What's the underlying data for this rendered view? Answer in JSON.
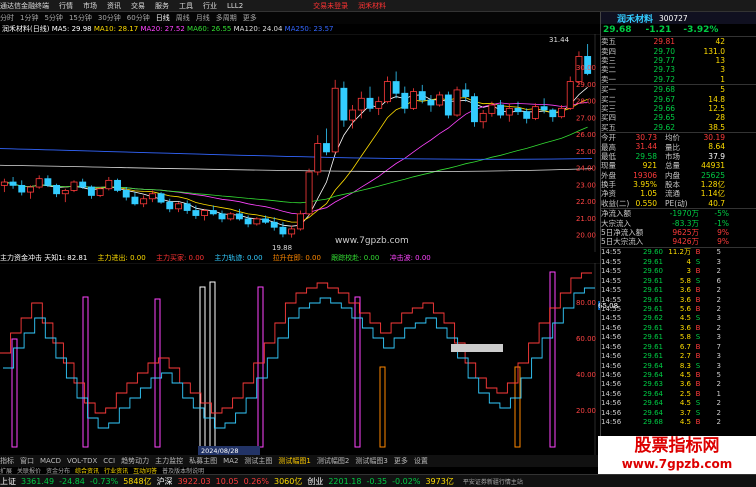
{
  "titlebar": {
    "items": [
      "通达信金融终端",
      "行情",
      "市场",
      "资讯",
      "交易",
      "服务",
      "工具",
      "行业",
      "LLL2"
    ],
    "promo1": "交易未登录",
    "promo2": "润禾材料"
  },
  "periods": [
    "分时",
    "1分钟",
    "5分钟",
    "15分钟",
    "30分钟",
    "60分钟",
    "日线",
    "周线",
    "月线",
    "多周期",
    "更多"
  ],
  "active_period": "日线",
  "ma_info": {
    "name": "润禾材料(日线)",
    "ma5": "MA5: 29.98",
    "ma10": "MA10: 28.17",
    "ma20": "MA20: 27.52",
    "ma60": "MA60: 26.55",
    "ma120": "MA120: 24.04",
    "ma250": "MA250: 23.57"
  },
  "price_axis": [
    "30.00",
    "29.00",
    "28.00",
    "27.00",
    "26.00",
    "25.00",
    "24.00",
    "23.00",
    "22.00",
    "21.00",
    "20.00"
  ],
  "high_label": "31.44",
  "low_label": "19.88",
  "watermark_mid": "www.7gpzb.com",
  "indicator_line": {
    "name": "主力资金冲击",
    "param": "天知1: 82.81",
    "i1": "主力进出: 0.00",
    "i2": "主力买家: 0.00",
    "i3": "主力轨迹: 0.00",
    "i4": "拉升在即: 0.00",
    "i5": "跟踪校赴: 0.00",
    "i6": "冲击波: 0.00"
  },
  "ind_axis": [
    "80.00",
    "60.00",
    "40.00",
    "20.00"
  ],
  "ind_marker": "65.08",
  "date_label": "2024/08/28",
  "tabs": [
    "指标",
    "窗口",
    "MACD",
    "VOL-TDX",
    "CCI",
    "趋势动力",
    "主力监控",
    "私募主图",
    "MA2",
    "测试主图",
    "测试幅图1",
    "测试幅图2",
    "测试幅图3",
    "更多",
    "设置"
  ],
  "link_items": [
    "扩展",
    "关联报价",
    "资金分布",
    "综合资讯",
    "行业资讯",
    "互动问答",
    "普及版本制说明"
  ],
  "stock": {
    "name": "润禾材料",
    "code": "300727",
    "price": "29.68",
    "change": "-1.21",
    "pct": "-3.92%"
  },
  "asks": [
    {
      "label": "卖五",
      "price": "29.81",
      "vol": "42"
    },
    {
      "label": "卖四",
      "price": "29.70",
      "vol": "131.0"
    },
    {
      "label": "卖三",
      "price": "29.77",
      "vol": "13"
    },
    {
      "label": "卖二",
      "price": "29.73",
      "vol": "3"
    },
    {
      "label": "卖一",
      "price": "29.72",
      "vol": "1"
    }
  ],
  "bids": [
    {
      "label": "买一",
      "price": "29.68",
      "vol": "5"
    },
    {
      "label": "买二",
      "price": "29.67",
      "vol": "14.8"
    },
    {
      "label": "买三",
      "price": "29.66",
      "vol": "12.5"
    },
    {
      "label": "买四",
      "price": "29.65",
      "vol": "28"
    },
    {
      "label": "买五",
      "price": "29.62",
      "vol": "38.5"
    }
  ],
  "stats": [
    {
      "l1": "今开",
      "v1": "30.73",
      "l2": "均价",
      "v2": "30.19"
    },
    {
      "l1": "最高",
      "v1": "31.44",
      "l2": "量比",
      "v2": "8.64"
    },
    {
      "l1": "最低",
      "v1": "29.58",
      "l2": "市场",
      "v2": "37.9"
    },
    {
      "l1": "现量",
      "v1": "921",
      "l2": "总量",
      "v2": "44931"
    },
    {
      "l1": "外盘",
      "v1": "19306",
      "l2": "内盘",
      "v2": "25625"
    },
    {
      "l1": "换手",
      "v1": "3.95%",
      "l2": "股本",
      "v2": "1.28亿"
    },
    {
      "l1": "净资",
      "v1": "1.05",
      "l2": "流通",
      "v2": "1.14亿"
    },
    {
      "l1": "收益(二)",
      "v1": "0.550",
      "l2": "PE(动)",
      "v2": "40.7"
    }
  ],
  "flows": [
    {
      "label": "净流入额",
      "value": "-1970万",
      "pct": "-5%"
    },
    {
      "label": "大宗流入",
      "value": "-83.3万",
      "pct": "-1%"
    },
    {
      "label": "5日净流入额",
      "value": "9625万",
      "pct": "9%"
    },
    {
      "label": "5日大宗流入",
      "value": "9426万",
      "pct": "9%"
    }
  ],
  "ticks": [
    {
      "t": "14:55",
      "p": "29.60",
      "v": "11.2万",
      "d": "B",
      "n": "5"
    },
    {
      "t": "14:55",
      "p": "29.61",
      "v": "4",
      "d": "S",
      "n": "3"
    },
    {
      "t": "14:55",
      "p": "29.60",
      "v": "3",
      "d": "B",
      "n": "2"
    },
    {
      "t": "14:55",
      "p": "29.61",
      "v": "5.8",
      "d": "S",
      "n": "6"
    },
    {
      "t": "14:55",
      "p": "29.61",
      "v": "3.6",
      "d": "B",
      "n": "2"
    },
    {
      "t": "14:55",
      "p": "29.61",
      "v": "3.6",
      "d": "B",
      "n": "2"
    },
    {
      "t": "14:55",
      "p": "29.61",
      "v": "5.6",
      "d": "B",
      "n": "2"
    },
    {
      "t": "14:55",
      "p": "29.62",
      "v": "4.5",
      "d": "S",
      "n": "3"
    },
    {
      "t": "14:56",
      "p": "29.61",
      "v": "3.6",
      "d": "B",
      "n": "2"
    },
    {
      "t": "14:56",
      "p": "29.61",
      "v": "5.8",
      "d": "S",
      "n": "3"
    },
    {
      "t": "14:56",
      "p": "29.61",
      "v": "6.7",
      "d": "B",
      "n": "7"
    },
    {
      "t": "14:56",
      "p": "29.61",
      "v": "2.7",
      "d": "B",
      "n": "3"
    },
    {
      "t": "14:56",
      "p": "29.64",
      "v": "8.3",
      "d": "S",
      "n": "3"
    },
    {
      "t": "14:56",
      "p": "29.64",
      "v": "4.5",
      "d": "B",
      "n": "5"
    },
    {
      "t": "14:56",
      "p": "29.63",
      "v": "3.6",
      "d": "B",
      "n": "2"
    },
    {
      "t": "14:56",
      "p": "29.64",
      "v": "2.5",
      "d": "B",
      "n": "1"
    },
    {
      "t": "14:56",
      "p": "29.64",
      "v": "4.5",
      "d": "S",
      "n": "2"
    },
    {
      "t": "14:56",
      "p": "29.64",
      "v": "3.7",
      "d": "S",
      "n": "2"
    },
    {
      "t": "14:56",
      "p": "29.68",
      "v": "4.5",
      "d": "B",
      "n": "2"
    }
  ],
  "status": [
    {
      "name": "上证",
      "val": "3361.49",
      "chg": "-24.84",
      "pct": "-0.73%",
      "vol": "5848亿"
    },
    {
      "name": "沪深",
      "val": "3922.03",
      "chg": "10.05",
      "pct": "0.26%",
      "vol": "3060亿"
    },
    {
      "name": "创业",
      "val": "2201.18",
      "chg": "-0.35",
      "pct": "-0.02%",
      "vol": "3973亿"
    }
  ],
  "status_right": "平安证券新疆行情主站",
  "side_labels": [
    "分",
    "笔",
    "价",
    "细",
    "势",
    "指",
    "联",
    "值",
    "序",
    "务",
    "成",
    "事",
    "析"
  ],
  "watermark_big": "股票指标网",
  "watermark_small": "www.7gpzb.com",
  "chart_data": {
    "type": "candlestick",
    "y_range": [
      19.5,
      31.8
    ],
    "candles": [
      [
        23.0,
        23.4,
        22.6,
        23.2
      ],
      [
        23.2,
        23.5,
        22.8,
        23.0
      ],
      [
        23.0,
        23.3,
        22.4,
        22.6
      ],
      [
        22.6,
        23.0,
        22.2,
        22.9
      ],
      [
        22.9,
        23.6,
        22.8,
        23.4
      ],
      [
        23.4,
        23.6,
        22.9,
        23.0
      ],
      [
        23.0,
        23.1,
        22.3,
        22.5
      ],
      [
        22.5,
        22.8,
        22.0,
        22.7
      ],
      [
        22.7,
        23.3,
        22.6,
        23.2
      ],
      [
        23.2,
        23.4,
        22.8,
        22.9
      ],
      [
        22.9,
        23.0,
        22.2,
        22.4
      ],
      [
        22.4,
        22.9,
        22.3,
        22.8
      ],
      [
        22.8,
        23.5,
        22.7,
        23.3
      ],
      [
        23.3,
        23.4,
        22.6,
        22.7
      ],
      [
        22.7,
        22.9,
        22.1,
        22.3
      ],
      [
        22.3,
        22.6,
        21.8,
        21.9
      ],
      [
        21.9,
        22.4,
        21.7,
        22.2
      ],
      [
        22.2,
        22.7,
        22.0,
        22.5
      ],
      [
        22.5,
        22.6,
        21.9,
        22.0
      ],
      [
        22.0,
        22.2,
        21.4,
        21.6
      ],
      [
        21.6,
        22.0,
        21.4,
        21.9
      ],
      [
        21.9,
        22.1,
        21.3,
        21.5
      ],
      [
        21.5,
        21.8,
        21.0,
        21.2
      ],
      [
        21.2,
        21.6,
        20.9,
        21.5
      ],
      [
        21.5,
        21.8,
        21.2,
        21.3
      ],
      [
        21.3,
        21.5,
        20.8,
        21.0
      ],
      [
        21.0,
        21.4,
        20.9,
        21.3
      ],
      [
        21.3,
        21.6,
        20.9,
        21.0
      ],
      [
        21.0,
        21.2,
        20.5,
        20.7
      ],
      [
        20.7,
        21.1,
        20.6,
        21.0
      ],
      [
        21.0,
        21.2,
        20.7,
        20.8
      ],
      [
        20.8,
        21.1,
        20.3,
        20.5
      ],
      [
        20.5,
        20.8,
        19.9,
        20.1
      ],
      [
        20.1,
        20.6,
        19.88,
        20.4
      ],
      [
        20.4,
        21.5,
        20.3,
        21.3
      ],
      [
        21.3,
        24.0,
        21.2,
        23.8
      ],
      [
        23.8,
        26.0,
        23.6,
        25.5
      ],
      [
        25.5,
        26.4,
        24.8,
        25.0
      ],
      [
        25.0,
        29.3,
        24.9,
        28.8
      ],
      [
        28.8,
        29.2,
        26.5,
        26.9
      ],
      [
        26.9,
        27.8,
        26.4,
        27.5
      ],
      [
        27.5,
        28.6,
        27.0,
        28.2
      ],
      [
        28.2,
        28.9,
        27.4,
        27.6
      ],
      [
        27.6,
        28.3,
        27.2,
        28.0
      ],
      [
        28.0,
        29.5,
        27.9,
        29.2
      ],
      [
        29.2,
        29.8,
        28.2,
        28.5
      ],
      [
        28.5,
        28.9,
        27.3,
        27.6
      ],
      [
        27.6,
        28.8,
        27.5,
        28.6
      ],
      [
        28.6,
        29.0,
        27.9,
        28.1
      ],
      [
        28.1,
        28.4,
        27.4,
        27.8
      ],
      [
        27.8,
        28.6,
        27.7,
        28.4
      ],
      [
        28.4,
        28.6,
        27.0,
        27.2
      ],
      [
        27.2,
        28.9,
        27.1,
        28.7
      ],
      [
        28.7,
        29.1,
        28.0,
        28.3
      ],
      [
        28.3,
        28.5,
        26.5,
        26.8
      ],
      [
        26.8,
        27.5,
        26.4,
        27.3
      ],
      [
        27.3,
        28.0,
        27.1,
        27.8
      ],
      [
        27.8,
        28.1,
        27.0,
        27.2
      ],
      [
        27.2,
        27.9,
        26.8,
        27.6
      ],
      [
        27.6,
        28.0,
        27.2,
        27.4
      ],
      [
        27.4,
        27.6,
        26.7,
        27.0
      ],
      [
        27.0,
        27.9,
        26.9,
        27.7
      ],
      [
        27.7,
        28.2,
        27.3,
        27.5
      ],
      [
        27.5,
        27.6,
        26.8,
        27.1
      ],
      [
        27.1,
        27.8,
        27.0,
        27.6
      ],
      [
        27.6,
        29.5,
        27.5,
        29.2
      ],
      [
        29.2,
        31.0,
        29.0,
        30.7
      ],
      [
        30.7,
        31.44,
        29.58,
        29.68
      ]
    ]
  }
}
